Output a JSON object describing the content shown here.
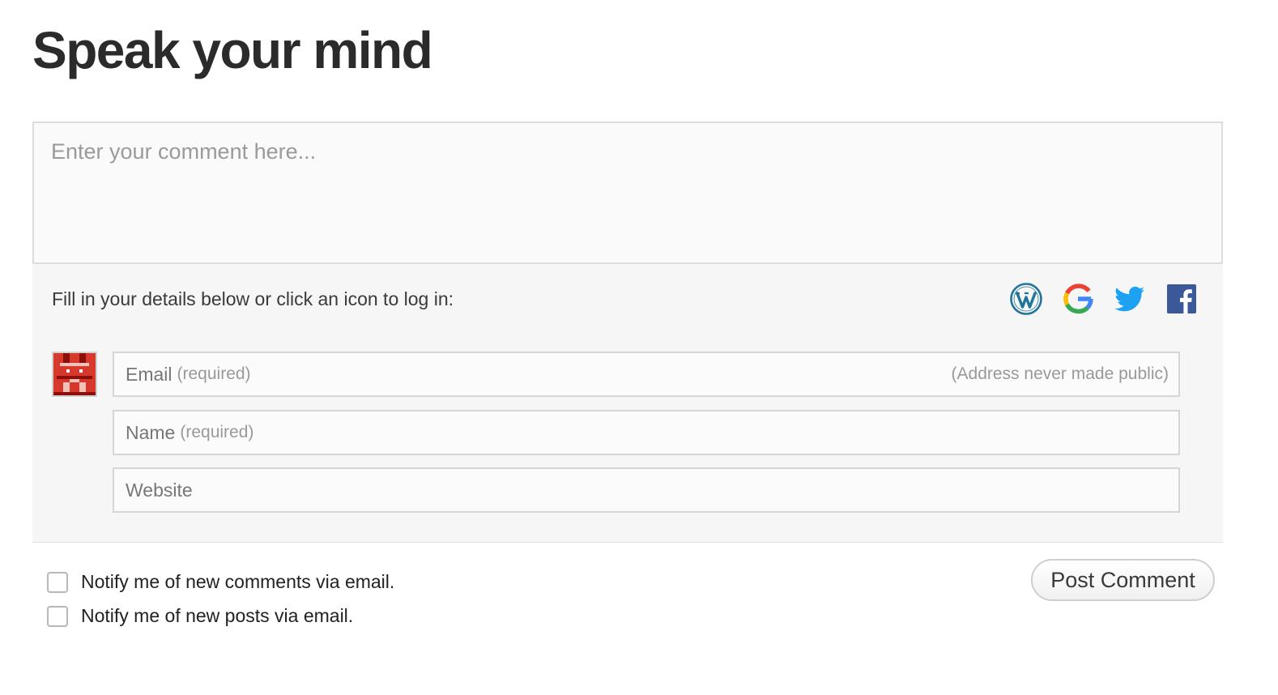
{
  "heading": "Speak your mind",
  "comment": {
    "placeholder": "Enter your comment here..."
  },
  "details": {
    "label": "Fill in your details below or click an icon to log in:",
    "login_icons": [
      "wordpress-icon",
      "google-icon",
      "twitter-icon",
      "facebook-icon"
    ]
  },
  "fields": {
    "email": {
      "label": "Email",
      "required": "(required)",
      "hint": "(Address never made public)"
    },
    "name": {
      "label": "Name",
      "required": "(required)"
    },
    "website": {
      "label": "Website"
    }
  },
  "notify": {
    "comments": "Notify me of new comments via email.",
    "posts": "Notify me of new posts via email."
  },
  "submit_label": "Post Comment",
  "colors": {
    "wordpress": "#21759b",
    "twitter": "#1da1f2",
    "facebook": "#3b5998",
    "avatar": "#c0201a"
  }
}
